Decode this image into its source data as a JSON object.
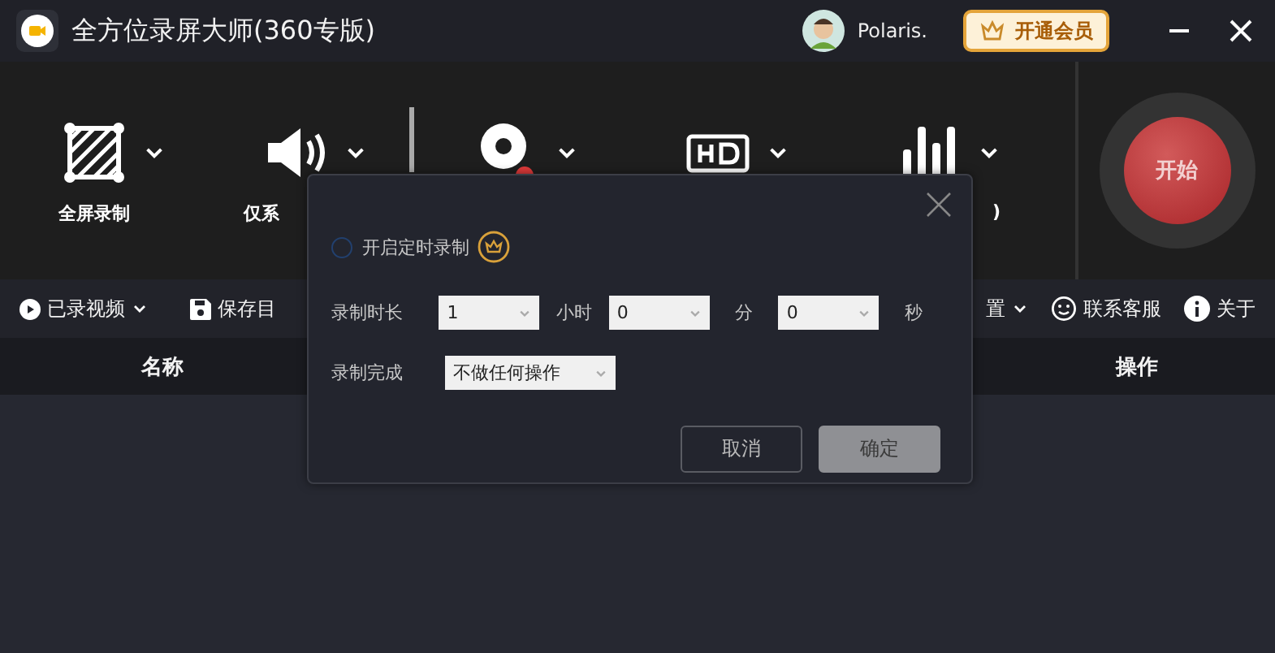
{
  "app": {
    "title": "全方位录屏大师(360专版)",
    "user": "Polaris.",
    "vip_button": "开通会员"
  },
  "tools": [
    {
      "kind": "fullscreen",
      "label": "全屏录制"
    },
    {
      "kind": "audio",
      "label": "仅系"
    },
    {
      "kind": "camera"
    },
    {
      "kind": "quality"
    },
    {
      "kind": "bitrate",
      "label": ")"
    }
  ],
  "start_button": "开始",
  "toolbar": {
    "left": [
      {
        "kind": "video",
        "label": "已录视频",
        "dropdown": true
      },
      {
        "kind": "save",
        "label": "保存目",
        "dropdown": false
      }
    ],
    "right": [
      {
        "kind": "settings",
        "label": "置",
        "dropdown": true
      },
      {
        "kind": "service",
        "label": "联系客服",
        "dropdown": false
      },
      {
        "kind": "about",
        "label": "关于",
        "dropdown": false
      }
    ]
  },
  "table": {
    "columns": [
      "名称",
      "操作"
    ]
  },
  "dialog": {
    "timer_toggle": {
      "label": "开启定时录制",
      "checked": false
    },
    "duration": {
      "label": "录制时长",
      "fields": [
        {
          "value": "1",
          "unit": "小时"
        },
        {
          "value": "0",
          "unit": "分"
        },
        {
          "value": "0",
          "unit": "秒"
        }
      ]
    },
    "on_finish": {
      "label": "录制完成",
      "value": "不做任何操作"
    },
    "buttons": [
      {
        "label": "取消",
        "kind": "secondary"
      },
      {
        "label": "确定",
        "kind": "primary"
      }
    ]
  }
}
